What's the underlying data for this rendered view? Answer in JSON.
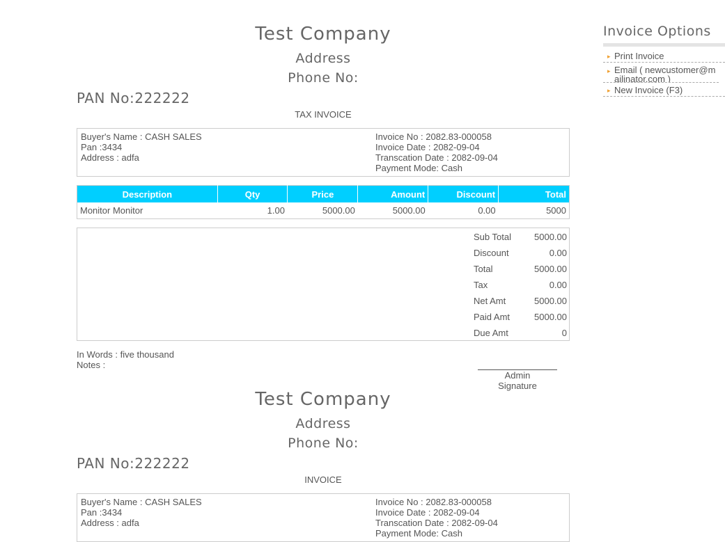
{
  "company": {
    "name": "Test Company",
    "address": "Address",
    "phone": "Phone No:",
    "pan": "PAN No:222222"
  },
  "invoice1": {
    "title": "TAX INVOICE"
  },
  "invoice2": {
    "title": "INVOICE"
  },
  "buyer": {
    "name": "Buyer's Name : CASH SALES",
    "pan": "Pan :3434",
    "address": "Address : adfa"
  },
  "invoice_info": {
    "number": "Invoice No : 2082.83-000058",
    "date": "Invoice Date : 2082-09-04",
    "transaction_date": "Transcation Date : 2082-09-04",
    "payment_mode": "Payment Mode: Cash"
  },
  "table": {
    "headers": [
      "Description",
      "Qty",
      "Price",
      "Amount",
      "Discount",
      "Total"
    ],
    "rows": [
      [
        "Monitor Monitor",
        "1.00",
        "5000.00",
        "5000.00",
        "0.00",
        "5000"
      ]
    ]
  },
  "totals": [
    {
      "label": "Sub Total",
      "value": "5000.00"
    },
    {
      "label": "Discount",
      "value": "0.00"
    },
    {
      "label": "Total",
      "value": "5000.00"
    },
    {
      "label": "Tax",
      "value": "0.00"
    },
    {
      "label": "Net Amt",
      "value": "5000.00"
    },
    {
      "label": "Paid Amt",
      "value": "5000.00"
    },
    {
      "label": "Due Amt",
      "value": "0"
    }
  ],
  "words": "In Words : five thousand",
  "notes": "Notes :",
  "signature": {
    "name": "Admin",
    "label": "Signature"
  },
  "sidebar": {
    "title": "Invoice Options",
    "items": [
      {
        "label": "Print Invoice"
      },
      {
        "label": "Email ( newcustomer@mailinator.com )"
      },
      {
        "label": "New Invoice (F3)"
      }
    ]
  },
  "colors": {
    "table_header": "#00cfff",
    "bullet": "#f0a030"
  }
}
